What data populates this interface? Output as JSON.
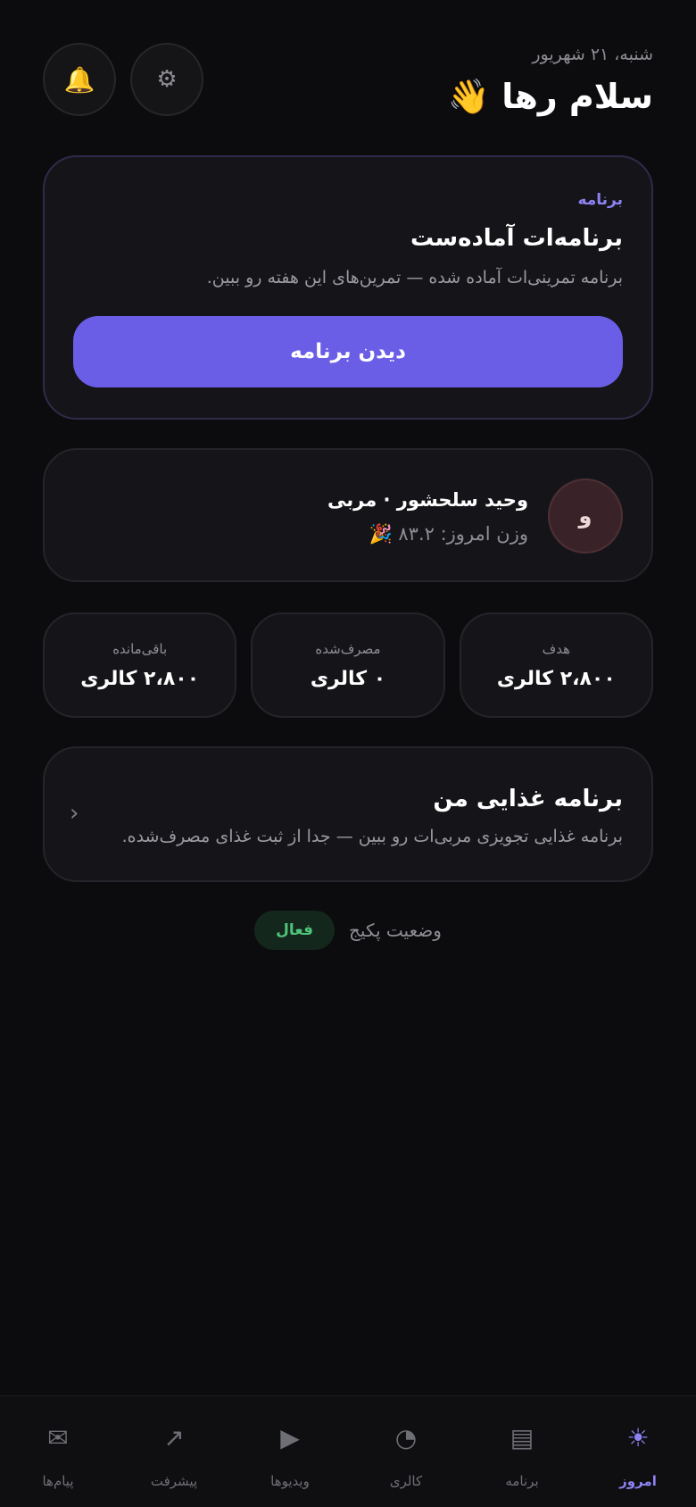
{
  "header": {
    "date": "شنبه، ۲۱ شهریور",
    "greeting": "سلام رها 👋",
    "bell_icon": "🔔",
    "gear_icon": "⚙"
  },
  "program_card": {
    "kicker": "برنامه",
    "title": "برنامه‌ات آماده‌ست",
    "description": "برنامه تمرینی‌ات آماده شده — تمرین‌های این هفته رو ببین.",
    "button_label": "دیدن برنامه"
  },
  "coach_card": {
    "avatar_initial": "و",
    "name": "وحید سلحشور · مربی",
    "weight_text": "وزن امروز: ۸۳.۲ 🎉"
  },
  "stats": [
    {
      "label": "هدف",
      "value": "۲،۸۰۰ کالری"
    },
    {
      "label": "مصرف‌شده",
      "value": "۰ کالری"
    },
    {
      "label": "باقی‌مانده",
      "value": "۲،۸۰۰ کالری"
    }
  ],
  "diet_card": {
    "title": "برنامه غذایی من",
    "description": "برنامه غذایی تجویزی مربی‌ات رو ببین — جدا از ثبت غذای مصرف‌شده.",
    "chevron": "‹"
  },
  "package_status": {
    "label": "وضعیت پکیج",
    "badge": "فعال"
  },
  "bottom_nav": {
    "items": [
      {
        "label": "پیام‌ها",
        "icon": "✉",
        "active": false
      },
      {
        "label": "پیشرفت",
        "icon": "↗",
        "active": false
      },
      {
        "label": "ویدیوها",
        "icon": "▶",
        "active": false
      },
      {
        "label": "کالری",
        "icon": "◔",
        "active": false
      },
      {
        "label": "برنامه",
        "icon": "▤",
        "active": false
      },
      {
        "label": "امروز",
        "icon": "☀",
        "active": true
      }
    ]
  },
  "colors": {
    "background": "#0c0c0e",
    "accent": "#6b5ee6",
    "accent_text": "#8d82f2",
    "success": "#4fc47a"
  }
}
